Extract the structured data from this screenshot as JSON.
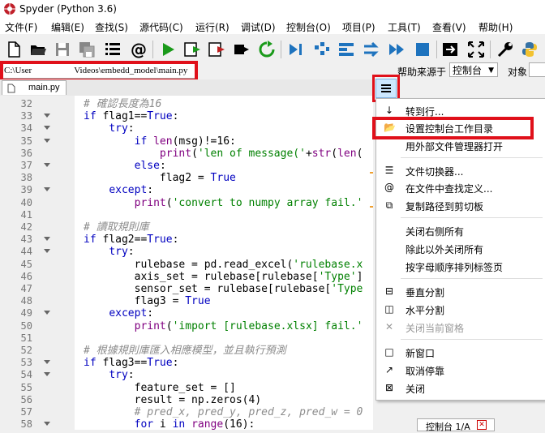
{
  "window": {
    "title": "Spyder (Python 3.6)"
  },
  "menubar": [
    {
      "label": "文件(F)"
    },
    {
      "label": "编辑(E)"
    },
    {
      "label": "查找(S)"
    },
    {
      "label": "源代码(C)"
    },
    {
      "label": "运行(R)"
    },
    {
      "label": "调试(D)"
    },
    {
      "label": "控制台(O)"
    },
    {
      "label": "项目(P)"
    },
    {
      "label": "工具(T)"
    },
    {
      "label": "查看(V)"
    },
    {
      "label": "帮助(H)"
    }
  ],
  "pathbar": {
    "path_left": "C:\\User",
    "path_right": "Videos\\embedd_model\\main.py",
    "help_source_label": "帮助来源于",
    "help_source_value": "控制台",
    "object_label": "对象"
  },
  "editor": {
    "tab_label": "main.py",
    "lines": [
      {
        "n": "32",
        "fold": false,
        "segs": [
          {
            "t": "        # 確認長度為16",
            "c": "cm"
          }
        ]
      },
      {
        "n": "33",
        "fold": true,
        "segs": [
          {
            "t": "        ",
            "c": ""
          },
          {
            "t": "if",
            "c": "kw"
          },
          {
            "t": " flag1==",
            "c": ""
          },
          {
            "t": "True",
            "c": "kw"
          },
          {
            "t": ":",
            "c": ""
          }
        ]
      },
      {
        "n": "34",
        "fold": true,
        "segs": [
          {
            "t": "            ",
            "c": ""
          },
          {
            "t": "try",
            "c": "kw"
          },
          {
            "t": ":",
            "c": ""
          }
        ]
      },
      {
        "n": "35",
        "fold": true,
        "segs": [
          {
            "t": "                ",
            "c": ""
          },
          {
            "t": "if",
            "c": "kw"
          },
          {
            "t": " ",
            "c": ""
          },
          {
            "t": "len",
            "c": "bi"
          },
          {
            "t": "(msg)!=16:",
            "c": ""
          }
        ]
      },
      {
        "n": "36",
        "fold": false,
        "segs": [
          {
            "t": "                    ",
            "c": ""
          },
          {
            "t": "print",
            "c": "bi"
          },
          {
            "t": "(",
            "c": ""
          },
          {
            "t": "'len of message('",
            "c": "str"
          },
          {
            "t": "+",
            "c": ""
          },
          {
            "t": "str",
            "c": "bi"
          },
          {
            "t": "(",
            "c": ""
          },
          {
            "t": "len",
            "c": "bi"
          },
          {
            "t": "(",
            "c": ""
          }
        ]
      },
      {
        "n": "37",
        "fold": true,
        "segs": [
          {
            "t": "                ",
            "c": ""
          },
          {
            "t": "else",
            "c": "kw"
          },
          {
            "t": ":",
            "c": ""
          }
        ]
      },
      {
        "n": "38",
        "fold": false,
        "segs": [
          {
            "t": "                    flag2 = ",
            "c": ""
          },
          {
            "t": "True",
            "c": "kw"
          }
        ]
      },
      {
        "n": "39",
        "fold": true,
        "segs": [
          {
            "t": "            ",
            "c": ""
          },
          {
            "t": "except",
            "c": "kw"
          },
          {
            "t": ":",
            "c": ""
          }
        ]
      },
      {
        "n": "40",
        "fold": false,
        "segs": [
          {
            "t": "                ",
            "c": ""
          },
          {
            "t": "print",
            "c": "bi"
          },
          {
            "t": "(",
            "c": ""
          },
          {
            "t": "'convert to numpy array fail.'",
            "c": "str"
          }
        ]
      },
      {
        "n": "41",
        "fold": false,
        "segs": [
          {
            "t": "",
            "c": ""
          }
        ]
      },
      {
        "n": "42",
        "fold": false,
        "segs": [
          {
            "t": "        # 讀取規則庫",
            "c": "cm"
          }
        ]
      },
      {
        "n": "43",
        "fold": true,
        "segs": [
          {
            "t": "        ",
            "c": ""
          },
          {
            "t": "if",
            "c": "kw"
          },
          {
            "t": " flag2==",
            "c": ""
          },
          {
            "t": "True",
            "c": "kw"
          },
          {
            "t": ":",
            "c": ""
          }
        ]
      },
      {
        "n": "44",
        "fold": true,
        "segs": [
          {
            "t": "            ",
            "c": ""
          },
          {
            "t": "try",
            "c": "kw"
          },
          {
            "t": ":",
            "c": ""
          }
        ]
      },
      {
        "n": "45",
        "fold": false,
        "segs": [
          {
            "t": "                rulebase = pd.read_excel(",
            "c": ""
          },
          {
            "t": "'rulebase.x",
            "c": "str"
          }
        ]
      },
      {
        "n": "46",
        "fold": false,
        "segs": [
          {
            "t": "                axis_set = rulebase[rulebase[",
            "c": ""
          },
          {
            "t": "'Type'",
            "c": "str"
          },
          {
            "t": "]",
            "c": ""
          }
        ]
      },
      {
        "n": "47",
        "fold": false,
        "segs": [
          {
            "t": "                sensor_set = rulebase[rulebase[",
            "c": ""
          },
          {
            "t": "'Type",
            "c": "str"
          }
        ]
      },
      {
        "n": "48",
        "fold": false,
        "segs": [
          {
            "t": "                flag3 = ",
            "c": ""
          },
          {
            "t": "True",
            "c": "kw"
          }
        ]
      },
      {
        "n": "49",
        "fold": true,
        "segs": [
          {
            "t": "            ",
            "c": ""
          },
          {
            "t": "except",
            "c": "kw"
          },
          {
            "t": ":",
            "c": ""
          }
        ]
      },
      {
        "n": "50",
        "fold": false,
        "segs": [
          {
            "t": "                ",
            "c": ""
          },
          {
            "t": "print",
            "c": "bi"
          },
          {
            "t": "(",
            "c": ""
          },
          {
            "t": "'import [rulebase.xlsx] fail.'",
            "c": "str"
          }
        ]
      },
      {
        "n": "51",
        "fold": false,
        "segs": [
          {
            "t": "",
            "c": ""
          }
        ]
      },
      {
        "n": "52",
        "fold": false,
        "segs": [
          {
            "t": "        # 根據規則庫匯入相應模型，並且執行預測",
            "c": "cm"
          }
        ]
      },
      {
        "n": "53",
        "fold": true,
        "segs": [
          {
            "t": "        ",
            "c": ""
          },
          {
            "t": "if",
            "c": "kw"
          },
          {
            "t": " flag3==",
            "c": ""
          },
          {
            "t": "True",
            "c": "kw"
          },
          {
            "t": ":",
            "c": ""
          }
        ]
      },
      {
        "n": "54",
        "fold": true,
        "segs": [
          {
            "t": "            ",
            "c": ""
          },
          {
            "t": "try",
            "c": "kw"
          },
          {
            "t": ":",
            "c": ""
          }
        ]
      },
      {
        "n": "55",
        "fold": false,
        "segs": [
          {
            "t": "                feature_set = []",
            "c": ""
          }
        ]
      },
      {
        "n": "56",
        "fold": false,
        "segs": [
          {
            "t": "                result = np.zeros(4)",
            "c": ""
          }
        ]
      },
      {
        "n": "57",
        "fold": false,
        "segs": [
          {
            "t": "                # pred_x, pred_y, pred_z, pred_w = 0",
            "c": "cm"
          }
        ]
      },
      {
        "n": "58",
        "fold": true,
        "segs": [
          {
            "t": "                ",
            "c": ""
          },
          {
            "t": "for",
            "c": "kw"
          },
          {
            "t": " i ",
            "c": ""
          },
          {
            "t": "in",
            "c": "kw"
          },
          {
            "t": " ",
            "c": ""
          },
          {
            "t": "range",
            "c": "bi"
          },
          {
            "t": "(16):",
            "c": ""
          }
        ]
      }
    ]
  },
  "context_menu": {
    "items": [
      {
        "icon": "goto-line-icon",
        "glyph": "↓",
        "label": "转到行...",
        "disabled": false
      },
      {
        "icon": "folder-icon",
        "glyph": "📂",
        "label": "设置控制台工作目录",
        "disabled": false
      },
      {
        "icon": "",
        "glyph": "",
        "label": "用外部文件管理器打开",
        "disabled": false
      },
      {
        "icon": "file-switcher-icon",
        "glyph": "☰",
        "label": "文件切换器...",
        "disabled": false
      },
      {
        "icon": "at-icon",
        "glyph": "@",
        "label": "在文件中查找定义...",
        "disabled": false
      },
      {
        "icon": "copy-icon",
        "glyph": "⧉",
        "label": "复制路径到剪切板",
        "disabled": false
      },
      {
        "icon": "",
        "glyph": "",
        "label": "关闭右侧所有",
        "disabled": false
      },
      {
        "icon": "",
        "glyph": "",
        "label": "除此以外关闭所有",
        "disabled": false
      },
      {
        "icon": "",
        "glyph": "",
        "label": "按字母顺序排列标签页",
        "disabled": false
      },
      {
        "icon": "split-vertical-icon",
        "glyph": "⊟",
        "label": "垂直分割",
        "disabled": false
      },
      {
        "icon": "split-horizontal-icon",
        "glyph": "◫",
        "label": "水平分割",
        "disabled": false
      },
      {
        "icon": "close-pane-icon",
        "glyph": "✕",
        "label": "关闭当前窗格",
        "disabled": true
      },
      {
        "icon": "new-window-icon",
        "glyph": "□",
        "label": "新窗口",
        "disabled": false
      },
      {
        "icon": "undock-icon",
        "glyph": "↗",
        "label": "取消停靠",
        "disabled": false
      },
      {
        "icon": "close-icon",
        "glyph": "⊠",
        "label": "关闭",
        "disabled": false
      }
    ]
  },
  "console_tab": {
    "label": "控制台 1/A"
  },
  "colors": {
    "highlight": "#e0101a",
    "keyword": "#0000c0",
    "string": "#008000",
    "comment": "#8c8c8c"
  }
}
